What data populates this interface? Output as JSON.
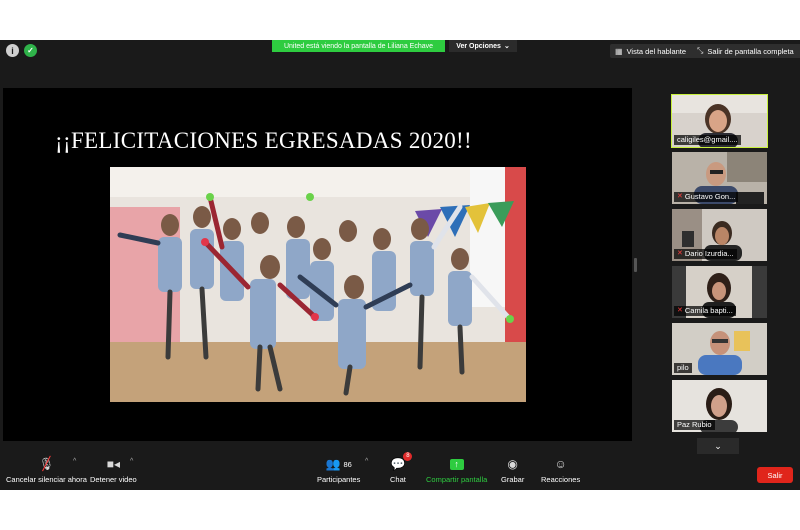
{
  "top_bar": {
    "share_banner": "United está viendo la pantalla de Liliana Echave",
    "view_options": "Ver Opciones",
    "speaker_view": "Vista del hablante",
    "exit_fullscreen": "Salir de pantalla completa"
  },
  "slide": {
    "title": "¡¡FELICITACIONES EGRESADAS 2020!!"
  },
  "gallery": {
    "participants": [
      {
        "name": "caligiles@gmail....",
        "muted": false,
        "active": true
      },
      {
        "name": "Gustavo Gon...",
        "muted": true,
        "active": false
      },
      {
        "name": "Dario Izurdia...",
        "muted": true,
        "active": false
      },
      {
        "name": "Camila bapti...",
        "muted": true,
        "active": false
      },
      {
        "name": "pilo",
        "muted": false,
        "active": false
      },
      {
        "name": "Paz Rubio",
        "muted": false,
        "active": false
      }
    ]
  },
  "toolbar": {
    "unmute_label": "Cancelar silenciar ahora",
    "stop_video_label": "Detener video",
    "participants_label": "Participantes",
    "participants_count": "86",
    "chat_label": "Chat",
    "chat_badge": "8",
    "share_label": "Compartir pantalla",
    "record_label": "Grabar",
    "reactions_label": "Reacciones",
    "leave_label": "Salir"
  },
  "colors": {
    "window_bg": "#1a1a1a",
    "share_green": "#2ecc40",
    "active_speaker": "#c8f03c",
    "leave_red": "#e0251b"
  }
}
